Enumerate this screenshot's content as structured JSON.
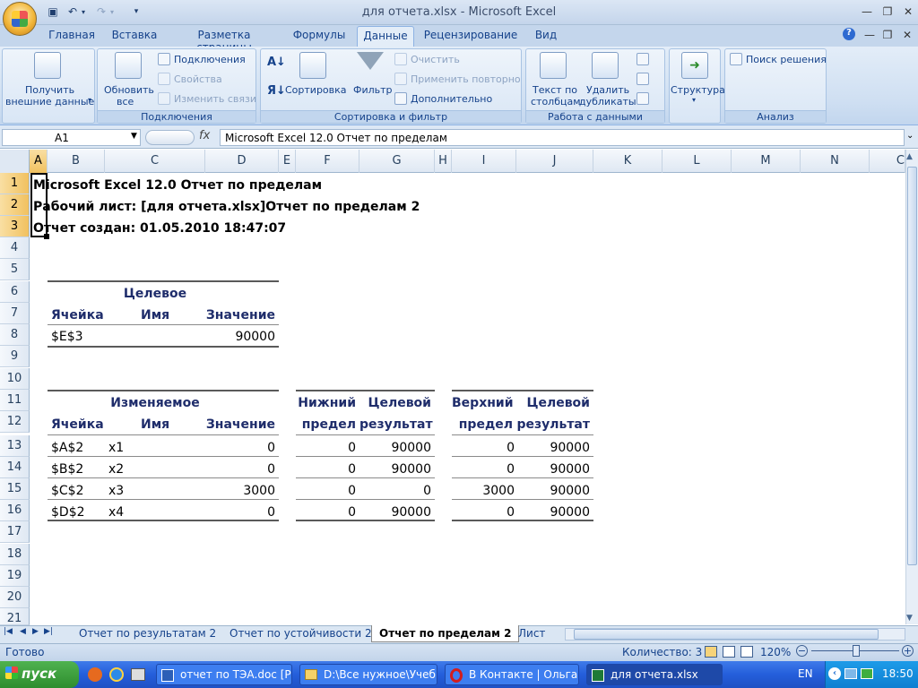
{
  "window": {
    "title": "для отчета.xlsx - Microsoft Excel"
  },
  "ribbon_tabs": [
    "Главная",
    "Вставка",
    "Разметка страницы",
    "Формулы",
    "Данные",
    "Рецензирование",
    "Вид"
  ],
  "ribbon": {
    "groups": {
      "connections": "Подключения",
      "sort_filter": "Сортировка и фильтр",
      "data_tools": "Работа с данными",
      "analysis": "Анализ"
    },
    "get_external_1": "Получить",
    "get_external_2": "внешние данные",
    "refresh_1": "Обновить",
    "refresh_2": "все",
    "connections": "Подключения",
    "properties": "Свойства",
    "edit_links": "Изменить связи",
    "sort": "Сортировка",
    "filter": "Фильтр",
    "clear": "Очистить",
    "reapply": "Применить повторно",
    "advanced": "Дополнительно",
    "text_to_cols_1": "Текст по",
    "text_to_cols_2": "столбцам",
    "remove_dup_1": "Удалить",
    "remove_dup_2": "дубликаты",
    "outline": "Структура",
    "solver": "Поиск решения"
  },
  "formula_bar": {
    "name_box": "A1",
    "fx": "fx",
    "content": "Microsoft Excel 12.0 Отчет по пределам"
  },
  "columns": [
    "A",
    "B",
    "C",
    "D",
    "E",
    "F",
    "G",
    "H",
    "I",
    "J",
    "K",
    "L",
    "M",
    "N",
    "C"
  ],
  "rows": [
    "1",
    "2",
    "3",
    "4",
    "5",
    "6",
    "7",
    "8",
    "9",
    "10",
    "11",
    "12",
    "13",
    "14",
    "15",
    "16",
    "17",
    "18",
    "19",
    "20",
    "21"
  ],
  "sheet": {
    "r1": "Microsoft Excel 12.0 Отчет по пределам",
    "r2": "Рабочий лист: [для отчета.xlsx]Отчет по пределам 2",
    "r3": "Отчет создан: 01.05.2010 18:47:07",
    "target": {
      "title": "Целевое",
      "h_cell": "Ячейка",
      "h_name": "Имя",
      "h_value": "Значение",
      "cell": "$E$3",
      "value": "90000"
    },
    "changing": {
      "title": "Изменяемое",
      "h_cell": "Ячейка",
      "h_name": "Имя",
      "h_value": "Значение",
      "lower_1": "Нижний",
      "lower_2": "предел",
      "result_1": "Целевой",
      "result_2": "результат",
      "upper_1": "Верхний",
      "upper_2": "предел",
      "result2_1": "Целевой",
      "result2_2": "результат",
      "rows": [
        {
          "cell": "$A$2",
          "name": "x1",
          "value": "0",
          "lower": "0",
          "lres": "90000",
          "upper": "0",
          "ures": "90000"
        },
        {
          "cell": "$B$2",
          "name": "x2",
          "value": "0",
          "lower": "0",
          "lres": "90000",
          "upper": "0",
          "ures": "90000"
        },
        {
          "cell": "$C$2",
          "name": "x3",
          "value": "3000",
          "lower": "0",
          "lres": "0",
          "upper": "3000",
          "ures": "90000"
        },
        {
          "cell": "$D$2",
          "name": "x4",
          "value": "0",
          "lower": "0",
          "lres": "90000",
          "upper": "0",
          "ures": "90000"
        }
      ]
    }
  },
  "sheet_tabs": [
    "Отчет по результатам 2",
    "Отчет по устойчивости 2",
    "Отчет по пределам 2",
    "Лист"
  ],
  "status": {
    "ready": "Готово",
    "count": "Количество: 3",
    "zoom": "120%"
  },
  "taskbar": {
    "start": "пуск",
    "tasks": [
      "отчет по ТЭА.doc [Р...",
      "D:\\Все нужное\\Учеб...",
      "В Контакте | Ольга ...",
      "для отчета.xlsx"
    ],
    "lang": "EN",
    "time": "18:50"
  }
}
